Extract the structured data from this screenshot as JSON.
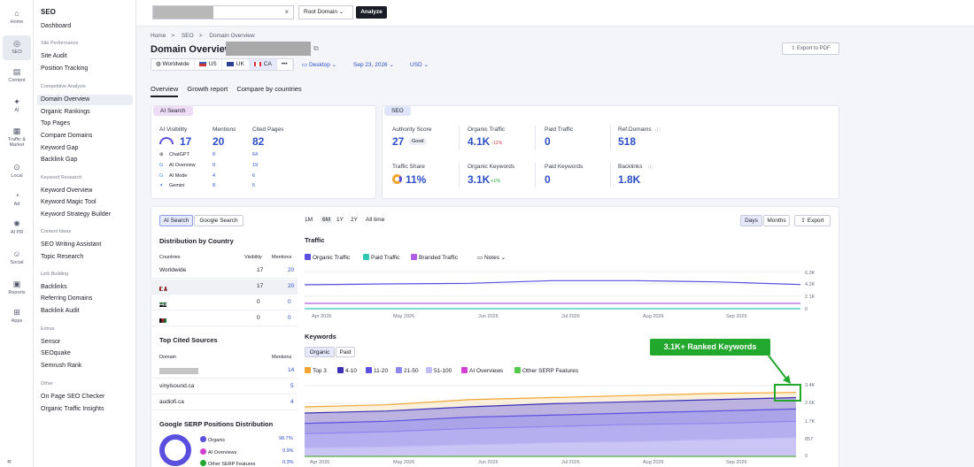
{
  "rail": [
    {
      "label": "Home",
      "icon": "home-icon"
    },
    {
      "label": "SEO",
      "icon": "seo-icon"
    },
    {
      "label": "Content",
      "icon": "content-icon"
    },
    {
      "label": "AI",
      "icon": "ai-icon"
    },
    {
      "label": "Traffic &",
      "label2": "Market",
      "icon": "traffic-icon"
    },
    {
      "label": "Local",
      "icon": "local-icon"
    },
    {
      "label": "Ad",
      "icon": "ad-icon"
    },
    {
      "label": "AI PR",
      "icon": "aipr-icon"
    },
    {
      "label": "Social",
      "icon": "social-icon"
    },
    {
      "label": "Reports",
      "icon": "reports-icon"
    },
    {
      "label": "Apps",
      "icon": "apps-icon"
    }
  ],
  "sidebar": {
    "title": "SEO",
    "dashboard": "Dashboard",
    "s1": "Site Performance",
    "site_audit": "Site Audit",
    "position_tracking": "Position Tracking",
    "s2": "Competitive Analysis",
    "domain_overview": "Domain Overview",
    "organic_rankings": "Organic Rankings",
    "top_pages": "Top Pages",
    "compare_domains": "Compare Domains",
    "keyword_gap": "Keyword Gap",
    "backlink_gap": "Backlink Gap",
    "s3": "Keyword Research",
    "keyword_overview": "Keyword Overview",
    "keyword_magic": "Keyword Magic Tool",
    "keyword_strategy": "Keyword Strategy Builder",
    "s4": "Content Ideas",
    "writing_assistant": "SEO Writing Assistant",
    "topic_research": "Topic Research",
    "s5": "Link Building",
    "backlinks": "Backlinks",
    "referring_domains": "Referring Domains",
    "backlink_audit": "Backlink Audit",
    "s6": "Extras",
    "sensor": "Sensor",
    "seoquake": "SEOquake",
    "semrush_rank": "Semrush Rank",
    "s7": "Other",
    "onpage_checker": "On Page SEO Checker",
    "organic_insights": "Organic Traffic Insights",
    "collapse": "«"
  },
  "topbar": {
    "root_domain": "Root Domain",
    "analyze": "Analyze",
    "clear": "×"
  },
  "breadcrumb": {
    "home": "Home",
    "seo": "SEO",
    "current": "Domain Overview",
    "sep": ">"
  },
  "page": {
    "title": "Domain Overview:",
    "export_pdf": "Export to PDF"
  },
  "databases": [
    "Worldwide",
    "US",
    "UK",
    "CA",
    "•••"
  ],
  "options": {
    "device": "Desktop",
    "date": "Sep 23, 2026",
    "currency": "USD"
  },
  "tabs": [
    "Overview",
    "Growth report",
    "Compare by countries"
  ],
  "ai_search": {
    "pill": "AI Search",
    "visibility_label": "AI Visibility",
    "visibility": "17",
    "mentions_label": "Mentions",
    "mentions": "20",
    "cited_label": "Cited Pages",
    "cited": "82",
    "rows": [
      {
        "name": "ChatGPT",
        "mentions": "8",
        "cited": "64"
      },
      {
        "name": "AI Overview",
        "mentions": "0",
        "cited": "19"
      },
      {
        "name": "AI Mode",
        "mentions": "4",
        "cited": "6"
      },
      {
        "name": "Gemini",
        "mentions": "8",
        "cited": "5"
      }
    ]
  },
  "seo": {
    "pill": "SEO",
    "authority_label": "Authority Score",
    "authority": "27",
    "authority_badge": "Good",
    "organic_traffic_label": "Organic Traffic",
    "organic_traffic": "4.1K",
    "organic_traffic_change": "-11%",
    "paid_traffic_label": "Paid Traffic",
    "paid_traffic": "0",
    "ref_domains_label": "Ref.Domains",
    "ref_domains": "518",
    "traffic_share_label": "Traffic Share",
    "traffic_share": "11%",
    "organic_kw_label": "Organic Keywords",
    "organic_kw": "3.1K",
    "organic_kw_change": "+1%",
    "paid_kw_label": "Paid Keywords",
    "paid_kw": "0",
    "backlinks_label": "Backlinks",
    "backlinks": "1.8K"
  },
  "panel": {
    "ai_search_btn": "AI Search",
    "google_search_btn": "Google Search",
    "ranges": [
      "1M",
      "6M",
      "1Y",
      "2Y",
      "All time"
    ],
    "days": "Days",
    "months": "Months",
    "export": "Export",
    "dist_title": "Distribution by Country",
    "col_countries": "Countries",
    "col_visibility": "Visibility",
    "col_mentions": "Mentions",
    "countries": [
      {
        "name": "Worldwide",
        "visibility": "17",
        "mentions": "20"
      },
      {
        "name": "CA",
        "visibility": "17",
        "mentions": "20"
      },
      {
        "name": "AE",
        "visibility": "0",
        "mentions": "0"
      },
      {
        "name": "AF",
        "visibility": "0",
        "mentions": "0"
      }
    ],
    "cited_title": "Top Cited Sources",
    "col_domain": "Domain",
    "col_mentions2": "Mentions",
    "sources": [
      {
        "name": "",
        "mentions": "14"
      },
      {
        "name": "vinylsound.ca",
        "mentions": "5"
      },
      {
        "name": "audiofi.ca",
        "mentions": "4"
      }
    ],
    "serp_title": "Google SERP Positions Distribution",
    "serp": [
      {
        "name": "Organic",
        "value": "98.7%",
        "color": "#5b4fe0"
      },
      {
        "name": "AI Overviews",
        "value": "0.9%",
        "color": "#d43fd4"
      },
      {
        "name": "Other SERP Features",
        "value": "0.3%",
        "color": "#22a82c"
      }
    ]
  },
  "traffic": {
    "title": "Traffic",
    "legend": [
      {
        "name": "Organic Traffic",
        "color": "#5b4fe0"
      },
      {
        "name": "Paid Traffic",
        "color": "#2fc7b4"
      },
      {
        "name": "Branded Traffic",
        "color": "#b25ee0"
      }
    ],
    "notes": "Notes",
    "y_ticks": [
      "6.3K",
      "4.2K",
      "2.1K",
      "0"
    ],
    "x_ticks": [
      "Apr 2026",
      "May 2026",
      "Jun 2026",
      "Jul 2026",
      "Aug 2026",
      "Sep 2026"
    ]
  },
  "keywords": {
    "title": "Keywords",
    "organic": "Organic",
    "paid": "Paid",
    "legend": [
      {
        "name": "Top 3",
        "color": "#f2a531"
      },
      {
        "name": "4-10",
        "color": "#3b2fb8"
      },
      {
        "name": "11-20",
        "color": "#5b4fe0"
      },
      {
        "name": "21-50",
        "color": "#8f86ee"
      },
      {
        "name": "51-100",
        "color": "#c3bdf7"
      },
      {
        "name": "AI Overviews",
        "color": "#d43fd4"
      },
      {
        "name": "Other SERP Features",
        "color": "#54c94a"
      }
    ],
    "y_ticks": [
      "3.4K",
      "2.6K",
      "1.7K",
      "857",
      "0"
    ],
    "x_ticks": [
      "Apr 2026",
      "May 2026",
      "Jun 2026",
      "Jul 2026",
      "Aug 2026",
      "Sep 2026"
    ],
    "callout": "3.1K+ Ranked Keywords"
  },
  "chart_data": [
    {
      "type": "line",
      "title": "Traffic",
      "x": [
        "Apr 2026",
        "May 2026",
        "Jun 2026",
        "Jul 2026",
        "Aug 2026",
        "Sep 2026"
      ],
      "ylim": [
        0,
        6300
      ],
      "series": [
        {
          "name": "Organic Traffic",
          "values": [
            4050,
            4200,
            4300,
            4750,
            4750,
            4550,
            4100
          ]
        },
        {
          "name": "Paid Traffic",
          "values": [
            0,
            0,
            0,
            0,
            0,
            0,
            0
          ]
        },
        {
          "name": "Branded Traffic",
          "values": [
            900,
            900,
            900,
            900,
            900,
            900,
            900
          ]
        }
      ]
    },
    {
      "type": "area",
      "title": "Keywords",
      "x": [
        "Apr 2026",
        "May 2026",
        "Jun 2026",
        "Jul 2026",
        "Aug 2026",
        "Sep 2026"
      ],
      "ylim": [
        0,
        3430
      ],
      "series": [
        {
          "name": "Top 3",
          "values": [
            2400,
            2500,
            2750,
            2850,
            2950,
            3050,
            3100
          ]
        },
        {
          "name": "4-10",
          "values": [
            2100,
            2200,
            2400,
            2550,
            2650,
            2750,
            2850
          ]
        },
        {
          "name": "11-20",
          "values": [
            1600,
            1700,
            1900,
            2000,
            2100,
            2200,
            2300
          ]
        },
        {
          "name": "21-50",
          "values": [
            1100,
            1200,
            1350,
            1450,
            1550,
            1600,
            1700
          ]
        },
        {
          "name": "51-100",
          "values": [
            400,
            450,
            550,
            650,
            700,
            800,
            900
          ]
        },
        {
          "name": "AI Overviews",
          "values": [
            0,
            0,
            0,
            0,
            0,
            0,
            0
          ]
        },
        {
          "name": "Other SERP Features",
          "values": [
            0,
            0,
            0,
            0,
            0,
            0,
            0
          ]
        }
      ]
    }
  ]
}
